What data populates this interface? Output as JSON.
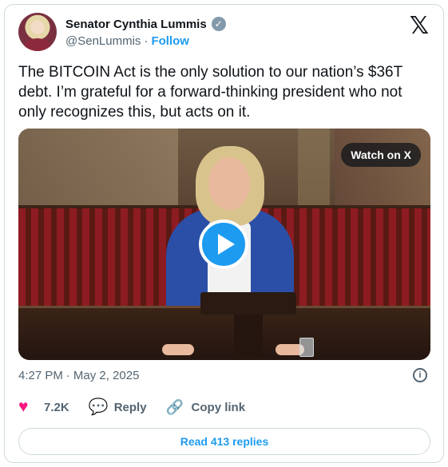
{
  "author": {
    "name": "Senator Cynthia Lummis",
    "handle": "@SenLummis",
    "separator": "·",
    "follow_label": "Follow",
    "verified_icon": "verified-badge-icon"
  },
  "tweet": {
    "text": "The BITCOIN Act is the only solution to our nation’s $36T debt. I’m grateful for a forward-thinking president who not only recognizes this, but acts on it."
  },
  "media": {
    "watch_label": "Watch on X",
    "play_icon": "play-icon"
  },
  "meta": {
    "time": "4:27 PM",
    "separator": "·",
    "date": "May 2, 2025",
    "info_icon": "info-icon"
  },
  "actions": {
    "likes": "7.2K",
    "reply_label": "Reply",
    "copy_link_label": "Copy link"
  },
  "read_replies_label": "Read 413 replies",
  "colors": {
    "accent": "#1d9bf0",
    "like": "#f91880",
    "muted": "#536471",
    "border": "#cfd9de"
  }
}
